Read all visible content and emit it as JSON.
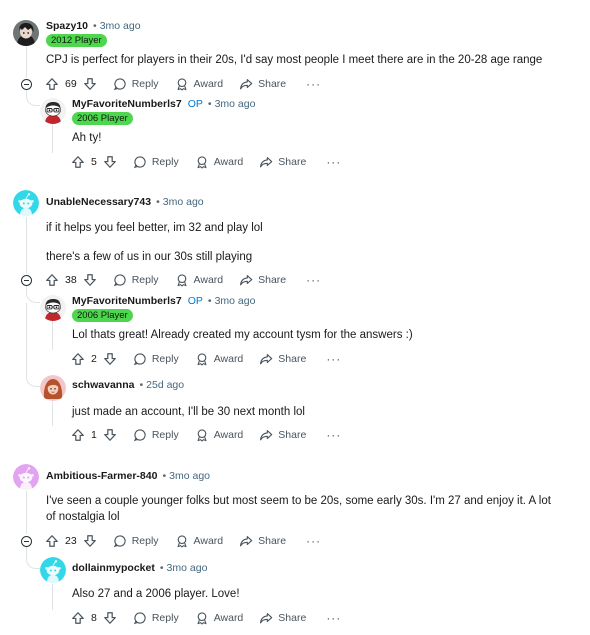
{
  "actions": {
    "reply": "Reply",
    "award": "Award",
    "share": "Share",
    "more": "···"
  },
  "comments": [
    {
      "username": "Spazy10",
      "op": "",
      "time": "3mo ago",
      "flair": "2012 Player",
      "text": "CPJ is perfect for players in their 20s, I'd say most people I meet there are in the 20-28 age range",
      "votes": "69",
      "avatar_icon": "anime-avatar-icon",
      "replies": [
        {
          "username": "MyFavoriteNumberls7",
          "op": "OP",
          "time": "3mo ago",
          "flair": "2006 Player",
          "text": "Ah ty!",
          "votes": "5",
          "avatar_icon": "snoo-glasses-avatar-icon"
        }
      ]
    },
    {
      "username": "UnableNecessary743",
      "op": "",
      "time": "3mo ago",
      "flair": "",
      "text": "if it helps you feel better, im 32 and play lol",
      "text2": "there's a few of us in our 30s still playing",
      "votes": "38",
      "avatar_icon": "snoo-cyan-avatar-icon",
      "replies": [
        {
          "username": "MyFavoriteNumberls7",
          "op": "OP",
          "time": "3mo ago",
          "flair": "2006 Player",
          "text": "Lol thats great! Already created my account tysm for the answers :)",
          "votes": "2",
          "avatar_icon": "snoo-glasses-avatar-icon"
        },
        {
          "username": "schwavanna",
          "op": "",
          "time": "25d ago",
          "flair": "",
          "text": "just made an account, I'll be 30 next month lol",
          "votes": "1",
          "avatar_icon": "woman-avatar-icon"
        }
      ]
    },
    {
      "username": "Ambitious-Farmer-840",
      "op": "",
      "time": "3mo ago",
      "flair": "",
      "text": "I've seen a couple younger folks but most seem to be 20s, some early 30s. I'm 27 and enjoy it. A lot of nostalgia lol",
      "votes": "23",
      "avatar_icon": "snoo-purple-avatar-icon",
      "replies": [
        {
          "username": "dollainmypocket",
          "op": "",
          "time": "3mo ago",
          "flair": "",
          "text": "Also 27 and a 2006 player. Love!",
          "votes": "8",
          "avatar_icon": "snoo-cyan-avatar-icon"
        }
      ]
    }
  ],
  "colors": {
    "flair": "#4ed64e",
    "op": "#0079d3",
    "time": "#44677e",
    "thread_line": "#dfe3e6"
  }
}
